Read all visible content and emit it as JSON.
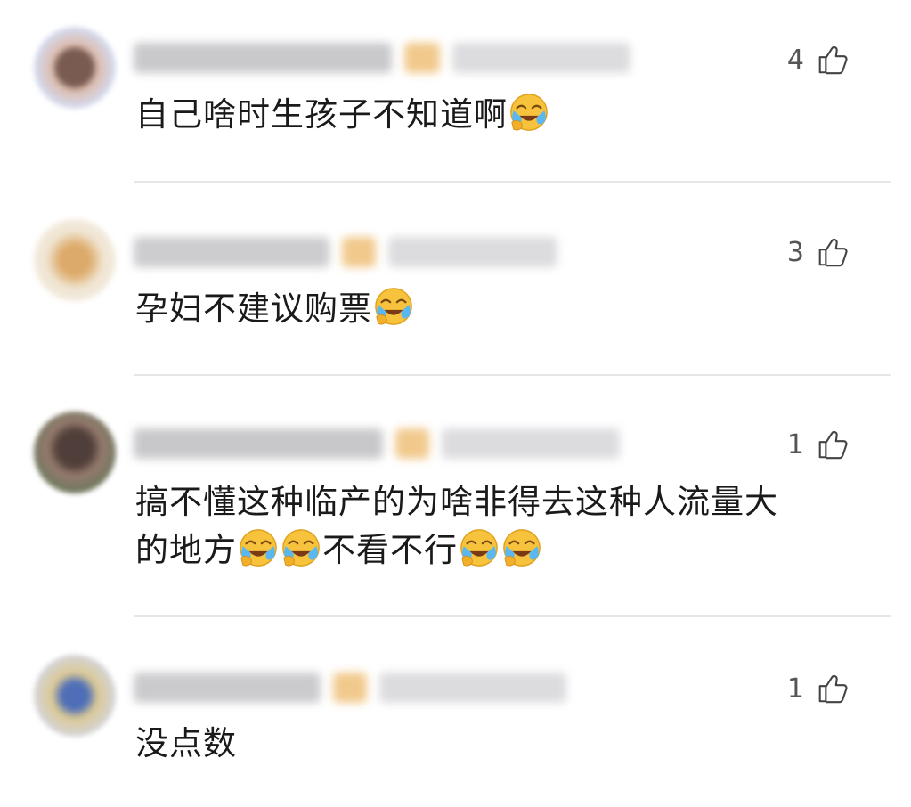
{
  "comments": [
    {
      "likes": "4",
      "text": "自己啥时生孩子不知道啊",
      "emojis_after": 1
    },
    {
      "likes": "3",
      "text": "孕妇不建议购票",
      "emojis_after": 1
    },
    {
      "likes": "1",
      "text_line1": "搞不懂这种临产的为啥非得去这种人流量大",
      "text_part_a": "的地方",
      "text_part_b": "不看不行"
    },
    {
      "likes": "1",
      "text": "没点数"
    }
  ],
  "icons": {
    "like": "thumbs-up-icon",
    "emoji": "crying-laughing-emoji-icon"
  }
}
